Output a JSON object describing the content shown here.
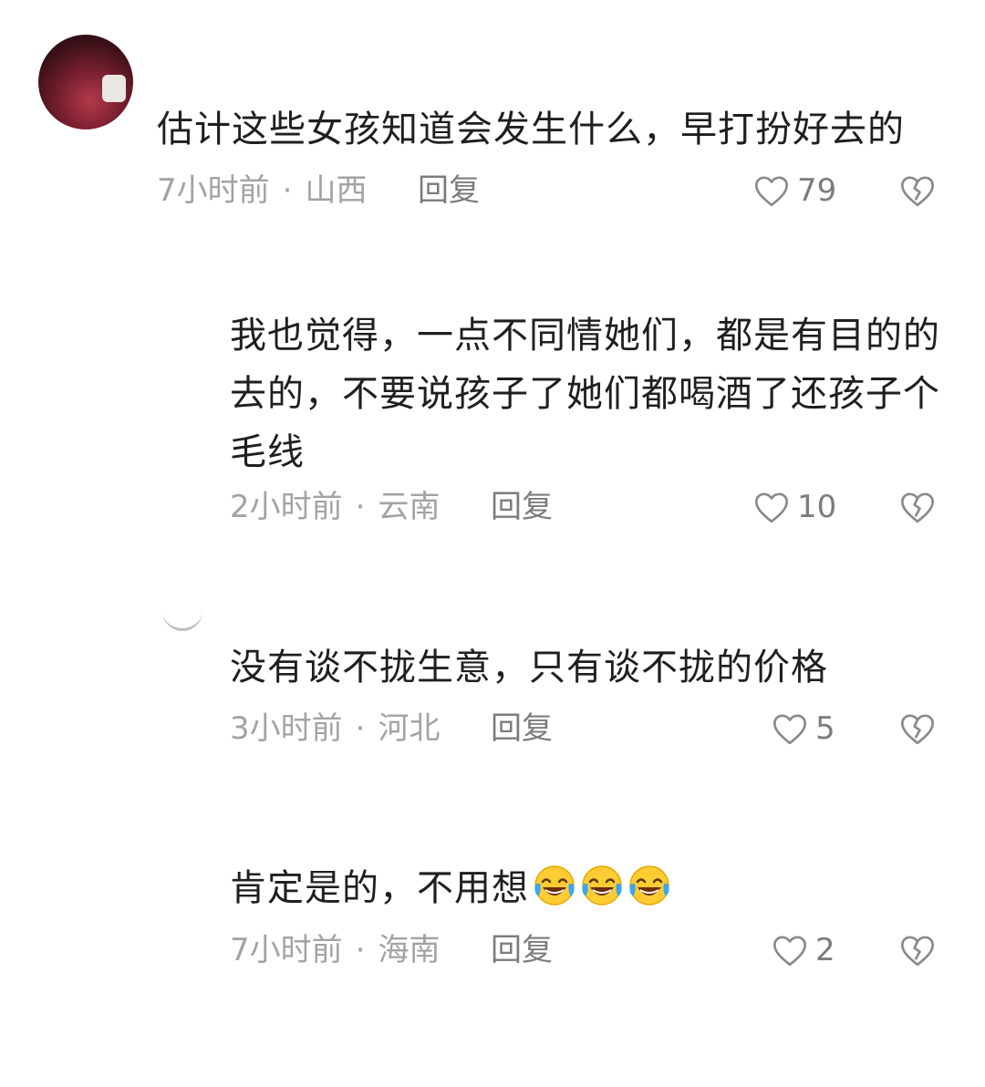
{
  "comments": [
    {
      "text": "估计这些女孩知道会发生什么，早打扮好去的",
      "time": "7小时前",
      "location": "山西",
      "reply_label": "回复",
      "likes": "79"
    },
    {
      "text": "我也觉得，一点不同情她们，都是有目的的去的，不要说孩子了她们都喝酒了还孩子个毛线",
      "time": "2小时前",
      "location": "云南",
      "reply_label": "回复",
      "likes": "10"
    },
    {
      "text": "没有谈不拢生意，只有谈不拢的价格",
      "time": "3小时前",
      "location": "河北",
      "reply_label": "回复",
      "likes": "5"
    },
    {
      "text": "肯定是的，不用想",
      "emoji": [
        "laugh-cry-emoji",
        "laugh-cry-emoji",
        "laugh-cry-emoji"
      ],
      "time": "7小时前",
      "location": "海南",
      "reply_label": "回复",
      "likes": "2"
    }
  ],
  "meta_separator": "·",
  "colors": {
    "text": "#1f1f1f",
    "meta": "#a3a3a3",
    "action": "#7c7c7c"
  }
}
